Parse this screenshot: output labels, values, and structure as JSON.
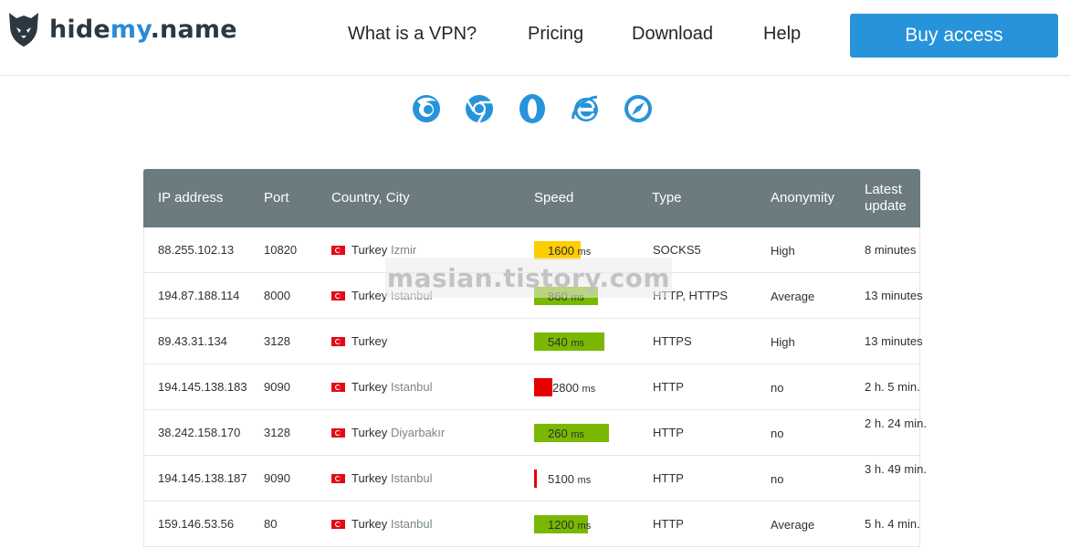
{
  "brand": {
    "prefix": "hide",
    "accent": "my",
    "suffix": ".name"
  },
  "nav": [
    "What is a VPN?",
    "Pricing",
    "Download",
    "Help"
  ],
  "buy_label": "Buy access",
  "browsers": [
    "firefox-icon",
    "chrome-icon",
    "opera-icon",
    "ie-icon",
    "safari-icon"
  ],
  "table": {
    "headers": [
      "IP address",
      "Port",
      "Country, City",
      "Speed",
      "Type",
      "Anonymity",
      "Latest update"
    ],
    "rows": [
      {
        "ip": "88.255.102.13",
        "port": "10820",
        "country": "Turkey",
        "city": "Izmir",
        "speed": "1600",
        "type": "SOCKS5",
        "anon": "High",
        "update": "8 minutes",
        "bar": "#ffcc00",
        "level": 0.62
      },
      {
        "ip": "194.87.188.114",
        "port": "8000",
        "country": "Turkey",
        "city": "Istanbul",
        "speed": "860",
        "type": "HTTP, HTTPS",
        "anon": "Average",
        "update": "13 minutes",
        "bar": "#7ab800",
        "level": 0.85
      },
      {
        "ip": "89.43.31.134",
        "port": "3128",
        "country": "Turkey",
        "city": "",
        "speed": "540",
        "type": "HTTPS",
        "anon": "High",
        "update": "13 minutes",
        "bar": "#7ab800",
        "level": 0.94
      },
      {
        "ip": "194.145.138.183",
        "port": "9090",
        "country": "Turkey",
        "city": "Istanbul",
        "speed": "2800",
        "type": "HTTP",
        "anon": "no",
        "update": "2 h. 5 min.",
        "bar": "#e60000",
        "level": 0.24
      },
      {
        "ip": "38.242.158.170",
        "port": "3128",
        "country": "Turkey",
        "city": "Diyarbakır",
        "speed": "260",
        "type": "HTTP",
        "anon": "no",
        "update": "2 h. 24 min.",
        "bar": "#7ab800",
        "level": 1.0
      },
      {
        "ip": "194.145.138.187",
        "port": "9090",
        "country": "Turkey",
        "city": "Istanbul",
        "speed": "5100",
        "type": "HTTP",
        "anon": "no",
        "update": "3 h. 49 min.",
        "bar": "#e60000",
        "level": 0.04
      },
      {
        "ip": "159.146.53.56",
        "port": "80",
        "country": "Turkey",
        "city": "Istanbul",
        "speed": "1200",
        "type": "HTTP",
        "anon": "Average",
        "update": "5 h. 4 min.",
        "bar": "#7ab800",
        "level": 0.72
      }
    ],
    "unit": "ms"
  },
  "watermark": "masian.tistory.com"
}
